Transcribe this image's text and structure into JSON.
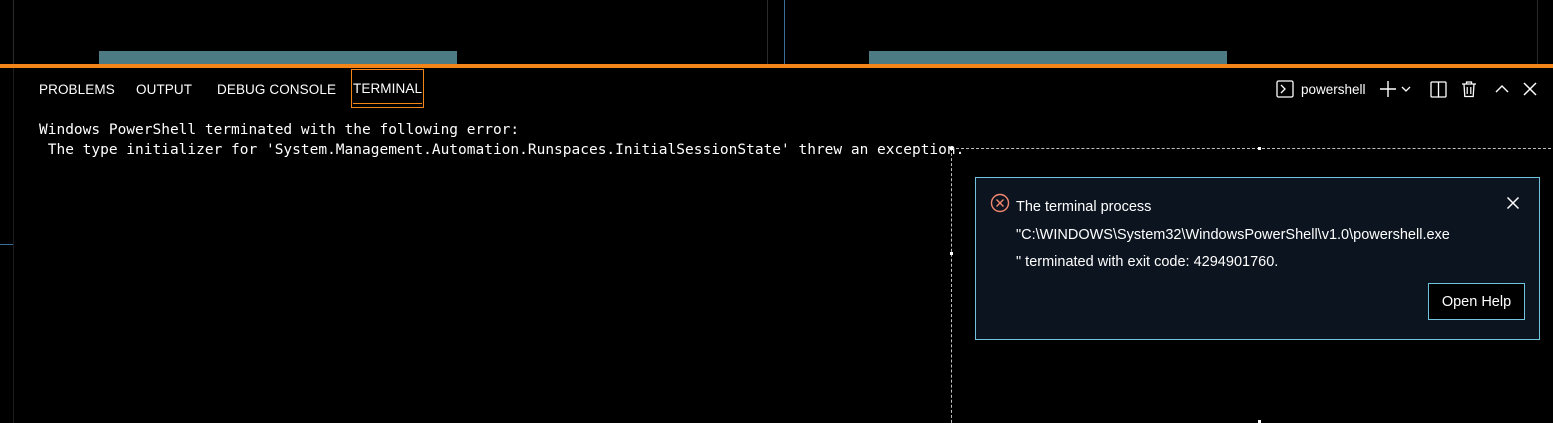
{
  "panel": {
    "tabs": [
      {
        "label": "PROBLEMS"
      },
      {
        "label": "OUTPUT"
      },
      {
        "label": "DEBUG CONSOLE"
      },
      {
        "label": "TERMINAL",
        "active": true
      }
    ],
    "toolbar": {
      "profile_icon": "terminal-powershell-icon",
      "profile_label": "powershell",
      "new_terminal_icon": "plus-icon",
      "launch_profile_icon": "chevron-down-icon",
      "split_icon": "split-terminal-icon",
      "kill_icon": "trash-icon",
      "maximize_icon": "chevron-up-icon",
      "close_icon": "close-icon"
    }
  },
  "terminal": {
    "lines": [
      "Windows PowerShell terminated with the following error:",
      " The type initializer for 'System.Management.Automation.Runspaces.InitialSessionState' threw an exception."
    ]
  },
  "notification": {
    "icon": "error-icon",
    "message_lines": [
      "The terminal process",
      "\"C:\\WINDOWS\\System32\\WindowsPowerShell\\v1.0\\powershell.exe",
      "\" terminated with exit code: 4294901760."
    ],
    "button_label": "Open Help",
    "close_icon": "close-icon"
  },
  "colors": {
    "focus_border": "#f38518",
    "contrast_border": "#6fc3df",
    "error": "#f48771",
    "background": "#000000"
  }
}
